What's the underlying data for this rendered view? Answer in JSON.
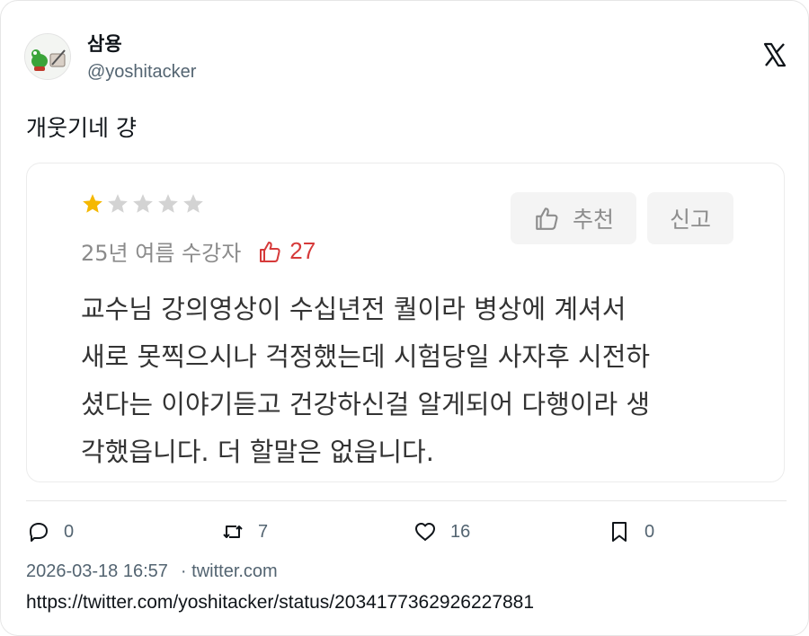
{
  "author": {
    "display_name": "삼용",
    "handle": "@yoshitacker"
  },
  "tweet": {
    "text": "개웃기네 걍"
  },
  "review": {
    "rating": 1,
    "max_rating": 5,
    "star_color_filled": "#f5b800",
    "star_color_empty": "#d3d3d3",
    "term": "25년 여름 수강자",
    "likes": "27",
    "like_color": "#d63a3a",
    "recommend_label": "추천",
    "report_label": "신고",
    "lines": [
      "교수님 강의영상이 수십년전 퀄이라 병상에 계셔서",
      "새로 못찍으시나 걱정했는데 시험당일 사자후 시전하",
      "셨다는 이야기듣고 건강하신걸 알게되어 다행이라 생",
      "각했읍니다. 더 할말은 없읍니다."
    ]
  },
  "actions": {
    "replies": "0",
    "retweets": "7",
    "likes": "16",
    "bookmarks": "0"
  },
  "footer": {
    "timestamp": "2026-03-18 16:57",
    "source": "· twitter.com",
    "url": "https://twitter.com/yoshitacker/status/2034177362926227881"
  }
}
